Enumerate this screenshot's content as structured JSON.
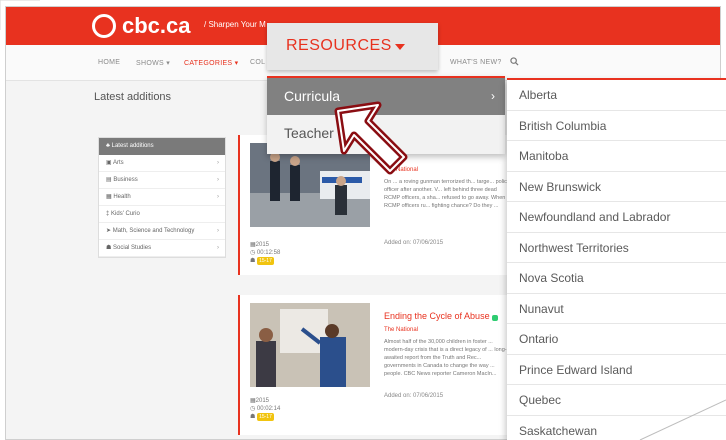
{
  "header": {
    "logo_text": "cbc.ca",
    "tagline": "/ Sharpen Your M"
  },
  "nav": {
    "items": [
      {
        "label": "HOME",
        "active": false
      },
      {
        "label": "SHOWS ▾",
        "active": false
      },
      {
        "label": "CATEGORIES ▾",
        "active": true
      },
      {
        "label": "COL",
        "active": false
      },
      {
        "label": "WHAT'S NEW?",
        "active": false
      }
    ],
    "search_icon": "search-icon"
  },
  "page": {
    "heading": "Latest additions"
  },
  "sidebar": {
    "header": "Latest additions",
    "items": [
      {
        "label": "Arts",
        "icon": "image-icon"
      },
      {
        "label": "Business",
        "icon": "briefcase-icon"
      },
      {
        "label": "Health",
        "icon": "health-icon"
      },
      {
        "label": "Kids' Curio",
        "icon": "child-icon"
      },
      {
        "label": "Math, Science and Technology",
        "icon": "rocket-icon"
      },
      {
        "label": "Social Studies",
        "icon": "people-icon"
      }
    ]
  },
  "cards": [
    {
      "title": "",
      "show": "The National",
      "desc": "On ... a roving gunman terrorized th... targe... police officer after another. V... left behind three dead RCMP officers, a sha... refused to go away. When RCMP officers ru... fighting chance? Do they ...",
      "added": "Added on: 07/06/2015",
      "year": "2015",
      "duration": "00:12:58",
      "grade": "15-17"
    },
    {
      "title": "Ending the Cycle of Abuse",
      "show": "The National",
      "desc": "Almost half of the 30,000 children in foster ... modern-day crisis that is a direct legacy of ... long-awaited report from the Truth and Rec... governments in Canada to change the way ... people. CBC News reporter Cameron MacIn...",
      "added": "Added on: 07/06/2015",
      "year": "2015",
      "duration": "00:02:14",
      "grade": "15-17"
    }
  ],
  "resources_menu": {
    "label": "RESOURCES",
    "items": [
      {
        "label": "Curricula",
        "highlighted": true
      },
      {
        "label": "Teacher Guides",
        "highlighted": false
      }
    ]
  },
  "curricula_submenu": {
    "items": [
      "Alberta",
      "British Columbia",
      "Manitoba",
      "New Brunswick",
      "Newfoundland and Labrador",
      "Northwest Territories",
      "Nova Scotia",
      "Nunavut",
      "Ontario",
      "Prince Edward Island",
      "Quebec",
      "Saskatchewan"
    ]
  },
  "colors": {
    "brand_red": "#e8321f",
    "menu_highlight": "#818181",
    "grade_badge": "#f1c40f"
  }
}
